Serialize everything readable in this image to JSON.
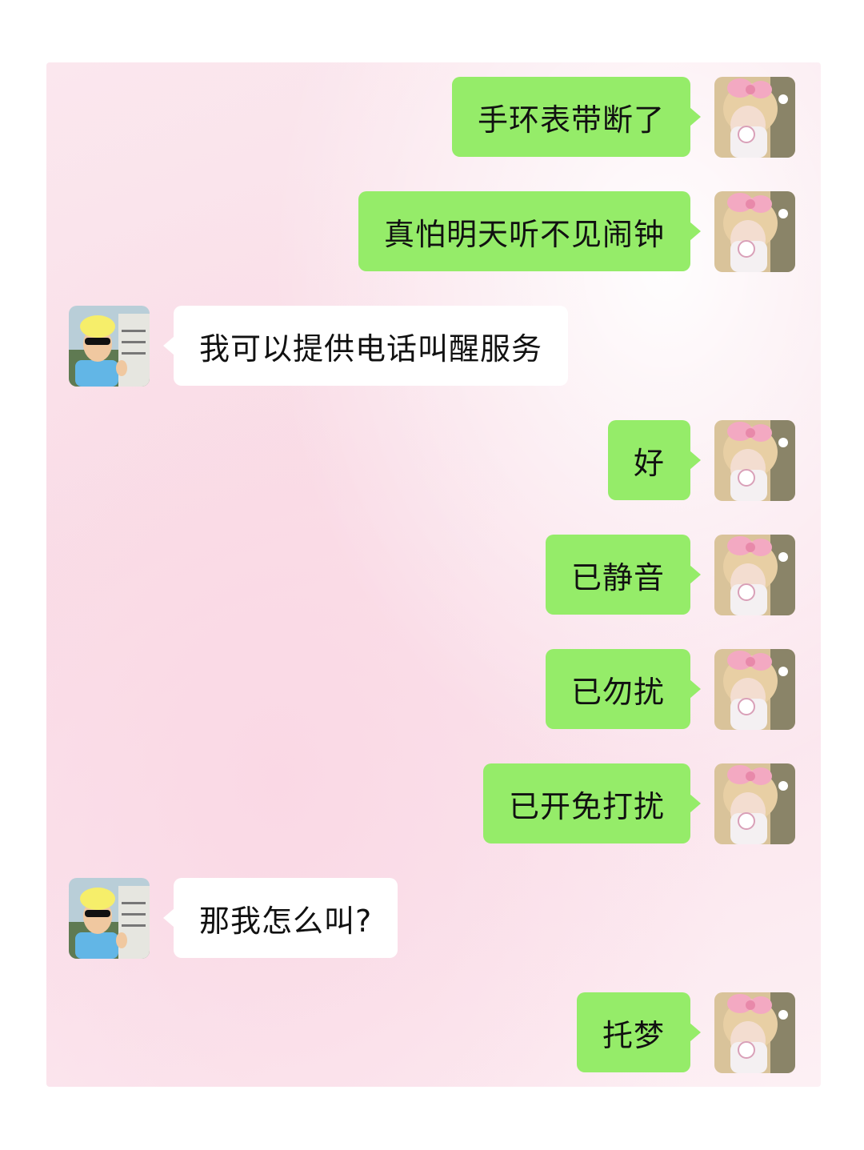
{
  "messages": [
    {
      "side": "right",
      "text": "手环表带断了"
    },
    {
      "side": "right",
      "text": "真怕明天听不见闹钟"
    },
    {
      "side": "left",
      "text": "我可以提供电话叫醒服务"
    },
    {
      "side": "right",
      "text": "好"
    },
    {
      "side": "right",
      "text": "已静音"
    },
    {
      "side": "right",
      "text": "已勿扰"
    },
    {
      "side": "right",
      "text": "已开免打扰"
    },
    {
      "side": "left",
      "text": "那我怎么叫?"
    },
    {
      "side": "right",
      "text": "托梦"
    }
  ],
  "colors": {
    "sent_bubble": "#95ec69",
    "received_bubble": "#ffffff",
    "text": "#111111"
  },
  "icons": {
    "self_avatar": "girl-with-pink-bow-avatar",
    "contact_avatar": "blond-man-sunglasses-avatar"
  }
}
